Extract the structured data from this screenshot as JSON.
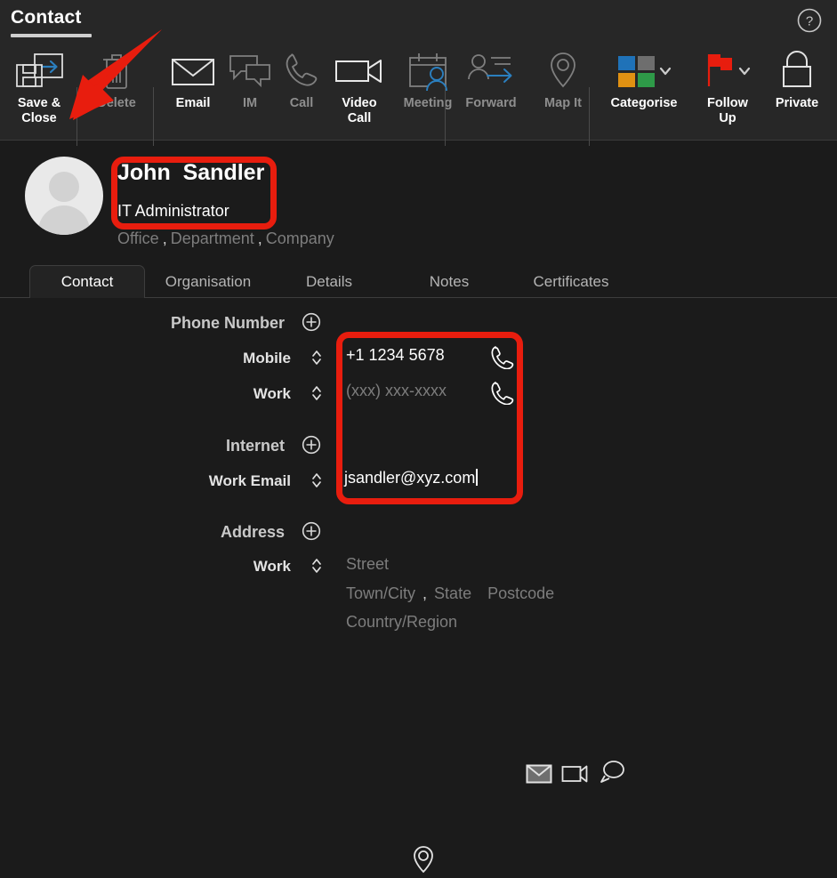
{
  "window": {
    "title": "Contact",
    "help_icon": "help-circle-icon"
  },
  "ribbon": {
    "groups": [
      {
        "name": "save-group",
        "items": [
          {
            "label": "Save &\nClose",
            "label_line1": "Save &",
            "label_line2": "Close",
            "icon": "save-and-close-icon",
            "enabled": true
          }
        ]
      },
      {
        "name": "delete-group",
        "items": [
          {
            "label": "Delete",
            "icon": "trash-icon",
            "enabled": false
          }
        ]
      },
      {
        "name": "communicate-group",
        "items": [
          {
            "label": "Email",
            "icon": "envelope-icon",
            "enabled": true
          },
          {
            "label": "IM",
            "icon": "chat-bubbles-icon",
            "enabled": false
          },
          {
            "label": "Call",
            "icon": "phone-icon",
            "enabled": false
          },
          {
            "label": "Video\nCall",
            "label_line1": "Video",
            "label_line2": "Call",
            "icon": "video-camera-icon",
            "enabled": true
          },
          {
            "label": "Meeting",
            "icon": "calendar-person-icon",
            "enabled": false
          }
        ]
      },
      {
        "name": "actions-group",
        "items": [
          {
            "label": "Forward",
            "icon": "forward-person-icon",
            "enabled": false
          },
          {
            "label": "Map It",
            "icon": "map-pin-icon",
            "enabled": false
          }
        ]
      },
      {
        "name": "tags-group",
        "items": [
          {
            "label": "Categorise",
            "icon": "categories-squares-icon",
            "enabled": true,
            "has_dropdown": true
          },
          {
            "label": "Follow\nUp",
            "label_line1": "Follow",
            "label_line2": "Up",
            "icon": "red-flag-icon",
            "enabled": true,
            "has_dropdown": true
          },
          {
            "label": "Private",
            "icon": "padlock-icon",
            "enabled": true
          }
        ]
      }
    ]
  },
  "contact": {
    "avatar": "default-person-avatar",
    "name": "John  Sandler",
    "job_title": "IT Administrator",
    "org_office": "Office",
    "org_department": "Department",
    "org_company": "Company",
    "org_sep": ","
  },
  "tabs": [
    {
      "label": "Contact",
      "active": true
    },
    {
      "label": "Organisation",
      "active": false
    },
    {
      "label": "Details",
      "active": false
    },
    {
      "label": "Notes",
      "active": false
    },
    {
      "label": "Certificates",
      "active": false
    }
  ],
  "form": {
    "sections": [
      {
        "label": "Phone Number",
        "add_icon": "plus-circle-icon"
      },
      {
        "label": "Internet",
        "add_icon": "plus-circle-icon"
      },
      {
        "label": "Address",
        "add_icon": "plus-circle-icon"
      }
    ],
    "phone": {
      "mobile": {
        "type_label": "Mobile",
        "value": "+1 1234 5678",
        "is_placeholder": false,
        "action_icon": "phone-call-icon"
      },
      "work": {
        "type_label": "Work",
        "value": "(xxx) xxx-xxxx",
        "is_placeholder": true,
        "action_icon": "phone-call-icon"
      }
    },
    "internet": {
      "work_email": {
        "type_label": "Work Email",
        "value": "jsandler@xyz.com",
        "is_placeholder": false,
        "focused": true,
        "action_icons": [
          "envelope-icon",
          "video-camera-icon",
          "chat-bubble-icon"
        ]
      }
    },
    "address": {
      "work": {
        "type_label": "Work",
        "street": "Street",
        "town_city": "Town/City",
        "state": "State",
        "postcode": "Postcode",
        "country_region": "Country/Region",
        "sep": ",",
        "action_icon": "map-pin-icon"
      }
    }
  },
  "annotations": {
    "accent_color": "#e81d0e",
    "arrow": "red-arrow-pointing-to-save-and-close",
    "highlight_name": "red-box-around-name-and-job-title",
    "highlight_fields": "red-box-around-phone-and-email-values"
  },
  "colors": {
    "background": "#1b1b1b",
    "ribbon": "#272727",
    "text_primary": "#ffffff",
    "text_dim": "#7d7d7d",
    "accent_red": "#e81d0e",
    "accent_blue": "#2b7fbf"
  }
}
